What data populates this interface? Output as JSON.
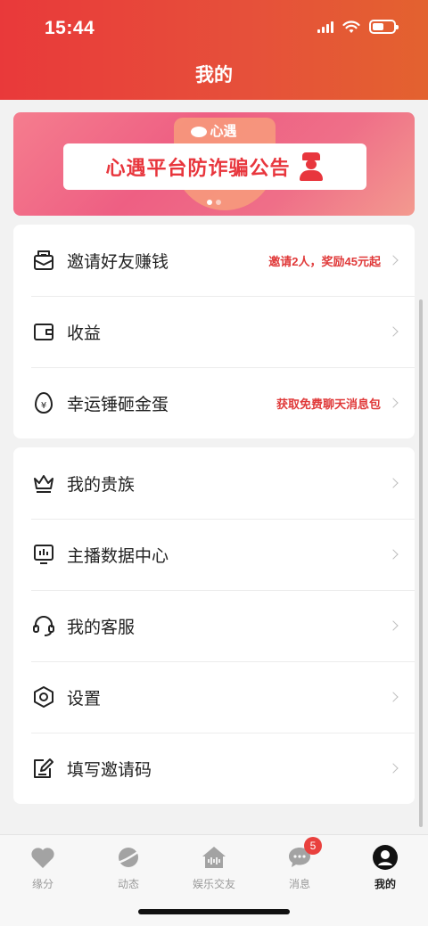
{
  "status_bar": {
    "time": "15:44"
  },
  "header": {
    "title": "我的"
  },
  "banner": {
    "logo_text": "心遇",
    "headline": "心遇平台防诈骗公告",
    "pages": 2,
    "active_page": 1
  },
  "group1": [
    {
      "label": "邀请好友赚钱",
      "hint": "邀请2人，奖励45元起",
      "icon": "invite-envelope-icon"
    },
    {
      "label": "收益",
      "hint": "",
      "icon": "wallet-icon"
    },
    {
      "label": "幸运锤砸金蛋",
      "hint": "获取免费聊天消息包",
      "icon": "golden-egg-icon"
    }
  ],
  "group2": [
    {
      "label": "我的贵族",
      "icon": "crown-icon"
    },
    {
      "label": "主播数据中心",
      "icon": "data-monitor-icon"
    },
    {
      "label": "我的客服",
      "icon": "headset-icon"
    },
    {
      "label": "设置",
      "icon": "settings-hexagon-icon"
    },
    {
      "label": "填写邀请码",
      "icon": "edit-note-icon"
    }
  ],
  "tabbar": {
    "tabs": [
      {
        "label": "缘分",
        "icon": "heart-icon"
      },
      {
        "label": "动态",
        "icon": "planet-icon"
      },
      {
        "label": "娱乐交友",
        "icon": "house-wave-icon"
      },
      {
        "label": "消息",
        "icon": "chat-bubble-icon",
        "badge": "5"
      },
      {
        "label": "我的",
        "icon": "user-avatar-icon",
        "active": true
      }
    ]
  },
  "colors": {
    "header_start": "#e9393a",
    "header_end": "#e3622f",
    "accent_red": "#e03a3a"
  }
}
